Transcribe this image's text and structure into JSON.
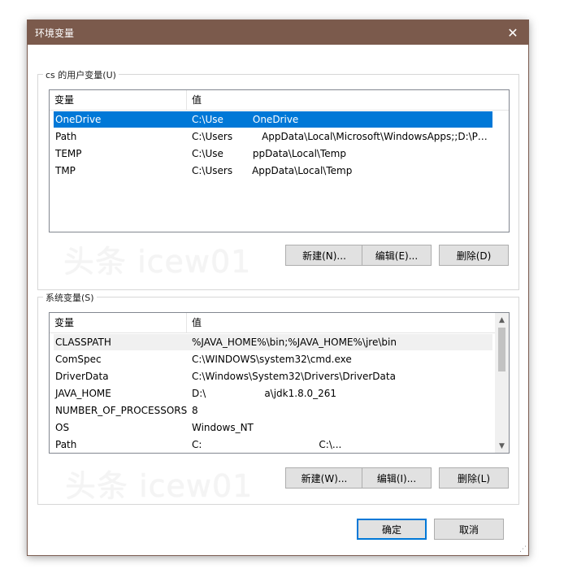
{
  "window": {
    "title": "环境变量",
    "close_glyph": "✕"
  },
  "user_vars": {
    "group_label": "cs 的用户变量(U)",
    "col_name": "变量",
    "col_value": "值",
    "rows": [
      {
        "name": "OneDrive",
        "value": "C:\\Use   OneDrive"
      },
      {
        "name": "Path",
        "value": "C:\\Users   AppData\\Local\\Microsoft\\WindowsApps;;D:\\Prog..."
      },
      {
        "name": "TEMP",
        "value": "C:\\Use   ppData\\Local\\Temp"
      },
      {
        "name": "TMP",
        "value": "C:\\Users  AppData\\Local\\Temp"
      }
    ],
    "btn_new": "新建(N)...",
    "btn_edit": "编辑(E)...",
    "btn_delete": "删除(D)"
  },
  "system_vars": {
    "group_label": "系统变量(S)",
    "col_name": "变量",
    "col_value": "值",
    "rows": [
      {
        "name": "CLASSPATH",
        "value": "%JAVA_HOME%\\bin;%JAVA_HOME%\\jre\\bin"
      },
      {
        "name": "ComSpec",
        "value": "C:\\WINDOWS\\system32\\cmd.exe"
      },
      {
        "name": "DriverData",
        "value": "C:\\Windows\\System32\\Drivers\\DriverData"
      },
      {
        "name": "JAVA_HOME",
        "value": "D:\\      a\\jdk1.8.0_261"
      },
      {
        "name": "NUMBER_OF_PROCESSORS",
        "value": "8"
      },
      {
        "name": "OS",
        "value": "Windows_NT"
      },
      {
        "name": "Path",
        "value": "C:            C:\\..."
      }
    ],
    "btn_new": "新建(W)...",
    "btn_edit": "编辑(I)...",
    "btn_delete": "删除(L)"
  },
  "watermark": "头条 icew01",
  "footer": {
    "ok": "确定",
    "cancel": "取消"
  },
  "colors": {
    "titlebar": "#7b5a4c",
    "selection": "#0078d7"
  }
}
